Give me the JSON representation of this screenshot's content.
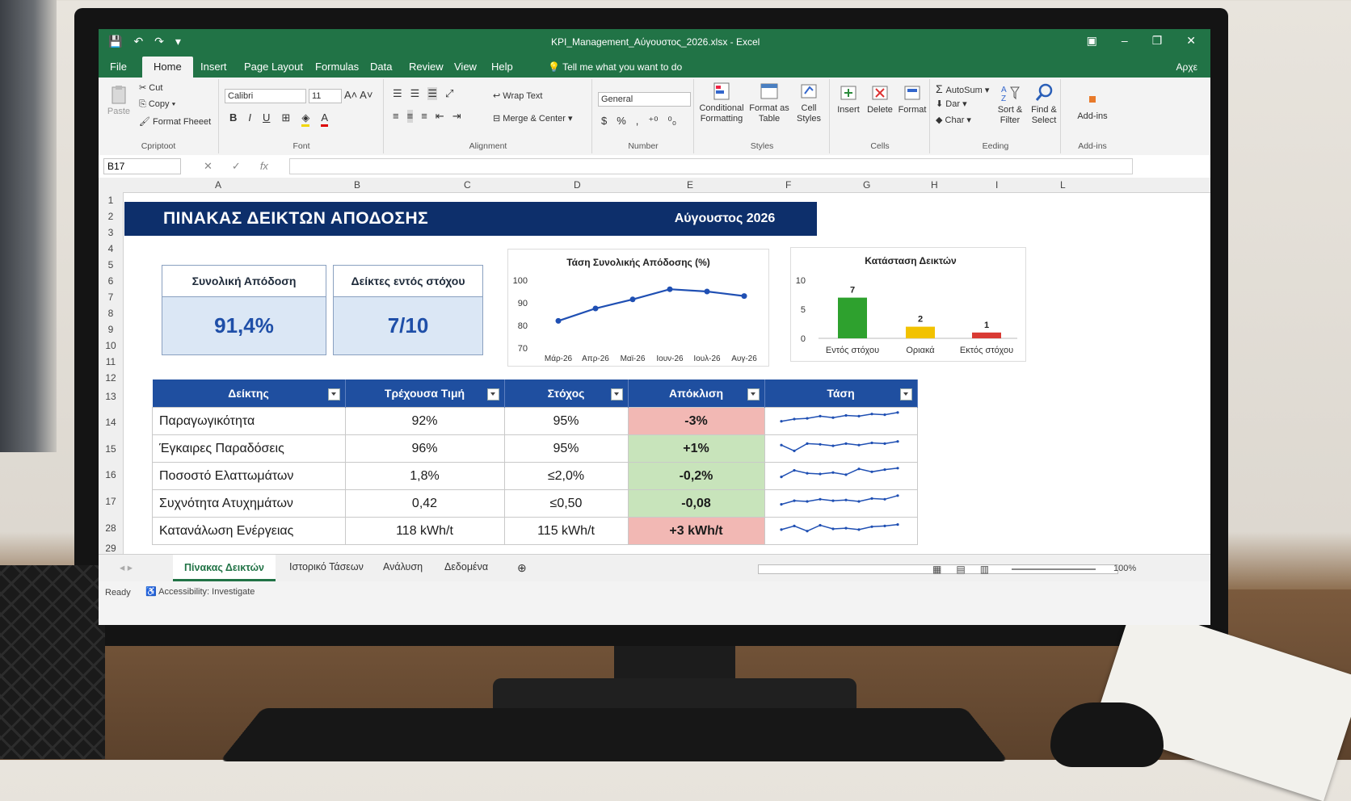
{
  "app": {
    "title": "KPI_Management_Αύγουστος_2026.xlsx - Excel",
    "share_label": "Αρχε"
  },
  "tabs": [
    "File",
    "Home",
    "Insert",
    "Page Layout",
    "Formulas",
    "Data",
    "Review",
    "View",
    "Help"
  ],
  "tell_me": "Tell me what you want to do",
  "ribbon": {
    "clipboard": {
      "paste": "Paste",
      "cut": "Cut",
      "copy": "Copy",
      "format_painter": "Format Fheeet",
      "label": "Cpriptoot"
    },
    "font": {
      "name": "Calibri",
      "size": "11",
      "label": "Font"
    },
    "alignment": {
      "wrap": "Wrap Text",
      "merge": "Merge & Center",
      "label": "Alignment"
    },
    "number": {
      "format": "General",
      "label": "Number"
    },
    "styles": {
      "conditional": "Conditional Formatting",
      "format_table": "Format as Table",
      "cell_styles": "Cell Styles",
      "label": "Styles"
    },
    "cells": {
      "insert": "Insert",
      "delete": "Delete",
      "format": "Format",
      "label": "Cells"
    },
    "editing": {
      "autosum": "AutoSum",
      "fill": "Dar",
      "clear": "Char",
      "sort": "Sort & Filter",
      "find": "Find & Select",
      "label": "Eeding"
    },
    "addins": {
      "addins": "Add-ins",
      "label": "Add-ins"
    }
  },
  "formula_bar": {
    "name_box": "B17"
  },
  "columns": [
    "A",
    "B",
    "C",
    "D",
    "E",
    "F",
    "G",
    "H",
    "I",
    "L"
  ],
  "rows": [
    "1",
    "2",
    "3",
    "4",
    "5",
    "6",
    "7",
    "8",
    "9",
    "10",
    "11",
    "12",
    "13",
    "14",
    "15",
    "16",
    "17",
    "28",
    "29"
  ],
  "dashboard": {
    "title": "ΠΙΝΑΚΑΣ ΔΕΙΚΤΩΝ ΑΠΟΔΟΣΗΣ",
    "period": "Αύγουστος 2026",
    "kpi1": {
      "label": "Συνολική Απόδοση",
      "value": "91,4%"
    },
    "kpi2": {
      "label": "Δείκτες εντός στόχου",
      "value": "7/10"
    }
  },
  "chart_data": [
    {
      "type": "line",
      "title": "Τάση Συνολικής Απόδοσης (%)",
      "categories": [
        "Μάρ-26",
        "Απρ-26",
        "Μαϊ-26",
        "Ιουν-26",
        "Ιουλ-26",
        "Αυγ-26"
      ],
      "values": [
        82,
        87.5,
        91.5,
        96,
        95,
        93
      ],
      "ylim": [
        70,
        100
      ],
      "yticks": [
        100,
        90,
        80,
        70
      ],
      "color": "#1f4fb3"
    },
    {
      "type": "bar",
      "title": "Κατάσταση Δεικτών",
      "categories": [
        "Εντός στόχου",
        "Οριακά",
        "Εκτός στόχου"
      ],
      "values": [
        7,
        2,
        1
      ],
      "ylim": [
        0,
        10
      ],
      "yticks": [
        10,
        5,
        0
      ],
      "colors": [
        "#2ea12e",
        "#f2c200",
        "#d93a33"
      ]
    }
  ],
  "table": {
    "headers": [
      "Δείκτης",
      "Τρέχουσα Τιμή",
      "Στόχος",
      "Απόκλιση",
      "Τάση"
    ],
    "rows": [
      {
        "name": "Παραγωγικότητα",
        "current": "92%",
        "target": "95%",
        "deviation": "-3%",
        "status": "neg",
        "trend": [
          0.35,
          0.5,
          0.55,
          0.7,
          0.6,
          0.75,
          0.7,
          0.85,
          0.8,
          0.95
        ]
      },
      {
        "name": "Έγκαιρες Παραδόσεις",
        "current": "96%",
        "target": "95%",
        "deviation": "+1%",
        "status": "pos",
        "trend": [
          0.6,
          0.2,
          0.7,
          0.65,
          0.55,
          0.7,
          0.6,
          0.75,
          0.7,
          0.85
        ]
      },
      {
        "name": "Ποσοστό Ελαττωμάτων",
        "current": "1,8%",
        "target": "≤2,0%",
        "deviation": "-0,2%",
        "status": "pos",
        "trend": [
          0.3,
          0.75,
          0.55,
          0.5,
          0.6,
          0.45,
          0.85,
          0.65,
          0.8,
          0.9
        ]
      },
      {
        "name": "Συχνότητα Ατυχημάτων",
        "current": "0,42",
        "target": "≤0,50",
        "deviation": "-0,08",
        "status": "pos",
        "trend": [
          0.3,
          0.55,
          0.5,
          0.65,
          0.55,
          0.6,
          0.5,
          0.7,
          0.65,
          0.9
        ]
      },
      {
        "name": "Κατανάλωση Ενέργειας",
        "current": "118 kWh/t",
        "target": "115 kWh/t",
        "deviation": "+3 kWh/t",
        "status": "neg",
        "trend": [
          0.45,
          0.7,
          0.35,
          0.75,
          0.5,
          0.55,
          0.45,
          0.65,
          0.7,
          0.8
        ]
      }
    ],
    "spark_color": "#1f4fb3"
  },
  "sheets": [
    "Πίνακας Δεικτών",
    "Ιστορικό Τάσεων",
    "Ανάλυση",
    "Δεδομένα"
  ],
  "status": {
    "ready": "Ready",
    "accessibility": "Accessibility: Investigate",
    "zoom": "100%"
  }
}
